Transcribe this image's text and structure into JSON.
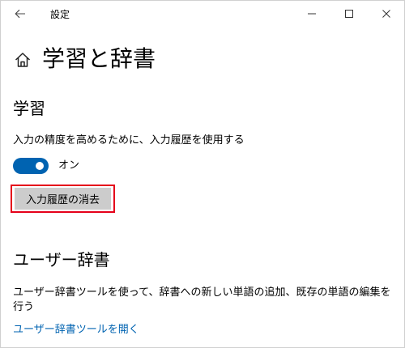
{
  "window": {
    "title": "設定",
    "back_icon": "back-arrow-icon",
    "controls": [
      "minimize-icon",
      "maximize-icon",
      "close-icon"
    ]
  },
  "page": {
    "title": "学習と辞書",
    "home_icon": "home-icon"
  },
  "learning": {
    "heading": "学習",
    "description": "入力の精度を高めるために、入力履歴を使用する",
    "toggle_state": "オン",
    "toggle_on": true,
    "accent_color": "#0063b1",
    "clear_button": "入力履歴の消去",
    "highlight_color": "#e5001a"
  },
  "user_dictionary": {
    "heading": "ユーザー辞書",
    "description": "ユーザー辞書ツールを使って、辞書への新しい単語の追加、既存の単語の編集を行う",
    "link": "ユーザー辞書ツールを開く"
  }
}
